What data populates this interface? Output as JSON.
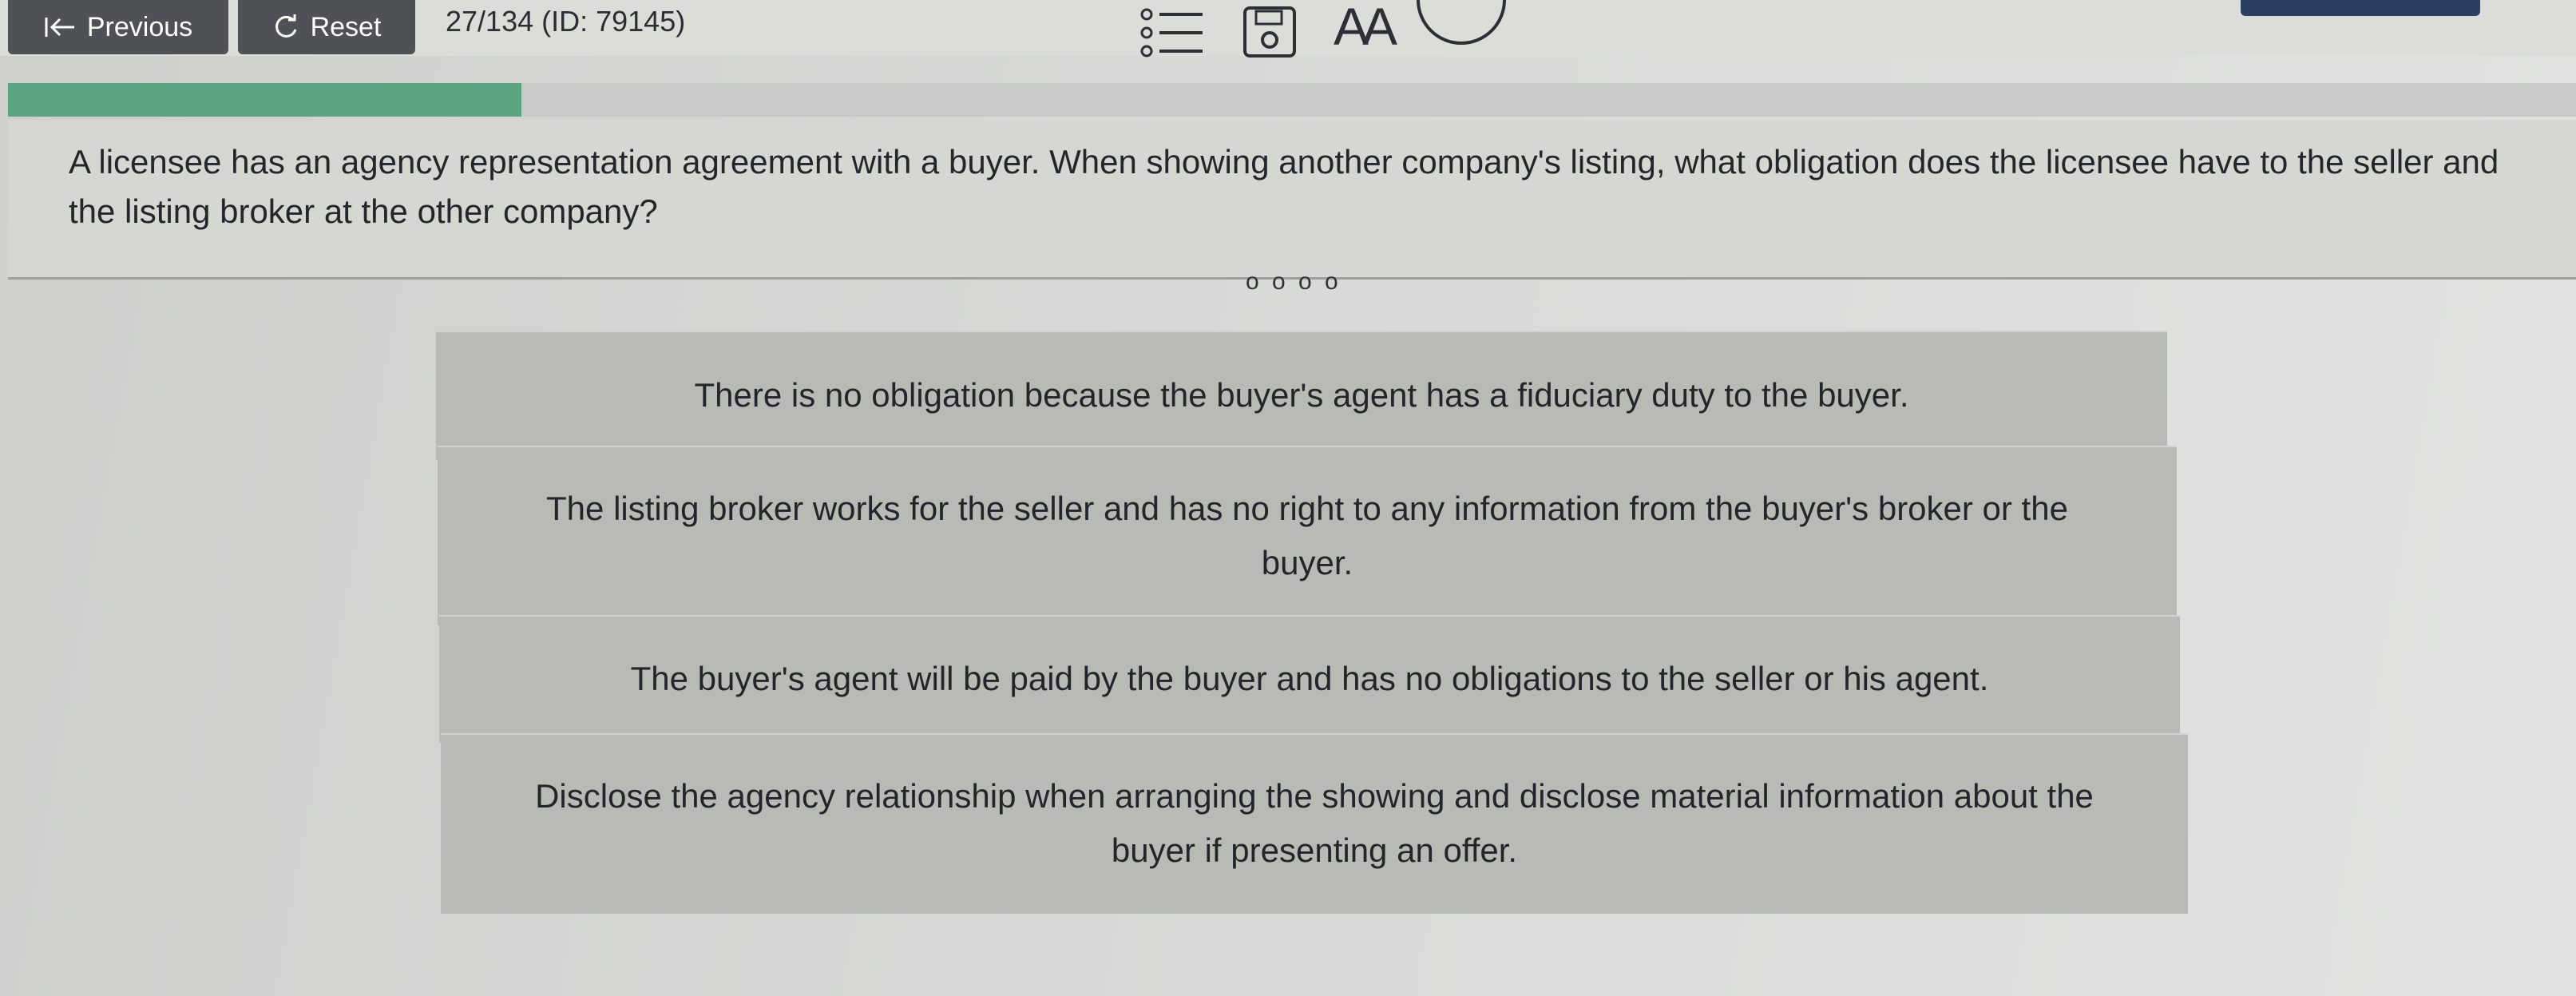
{
  "toolbar": {
    "previous_label": "Previous",
    "reset_label": "Reset",
    "position": "27/134 (ID: 79145)",
    "font_size_label": "AA"
  },
  "progress": {
    "fraction": 0.2
  },
  "question": {
    "text": "A licensee has an agency representation agreement with a buyer. When showing another company's listing, what obligation does the licensee have to the seller and the listing broker at the other company?"
  },
  "answer_indicator": "o o o o",
  "choices": [
    {
      "text": "There is no obligation because the buyer's agent has a fiduciary duty to the buyer."
    },
    {
      "text": "The listing broker works for the seller and has no right to any information from the buyer's broker or the buyer."
    },
    {
      "text": "The buyer's agent will be paid by the buyer and has no obligations to the seller or his agent."
    },
    {
      "text": "Disclose the agency relationship when arranging the showing and disclose material information about the buyer if presenting an offer."
    }
  ],
  "colors": {
    "button_bg": "#4e5256",
    "progress_fill": "#5aa57f",
    "choice_bg": "#b9bab6",
    "accent_bar": "#2b3f63"
  },
  "icons": [
    "first-page-icon",
    "refresh-icon",
    "question-list-icon",
    "save-icon",
    "timer-icon"
  ]
}
